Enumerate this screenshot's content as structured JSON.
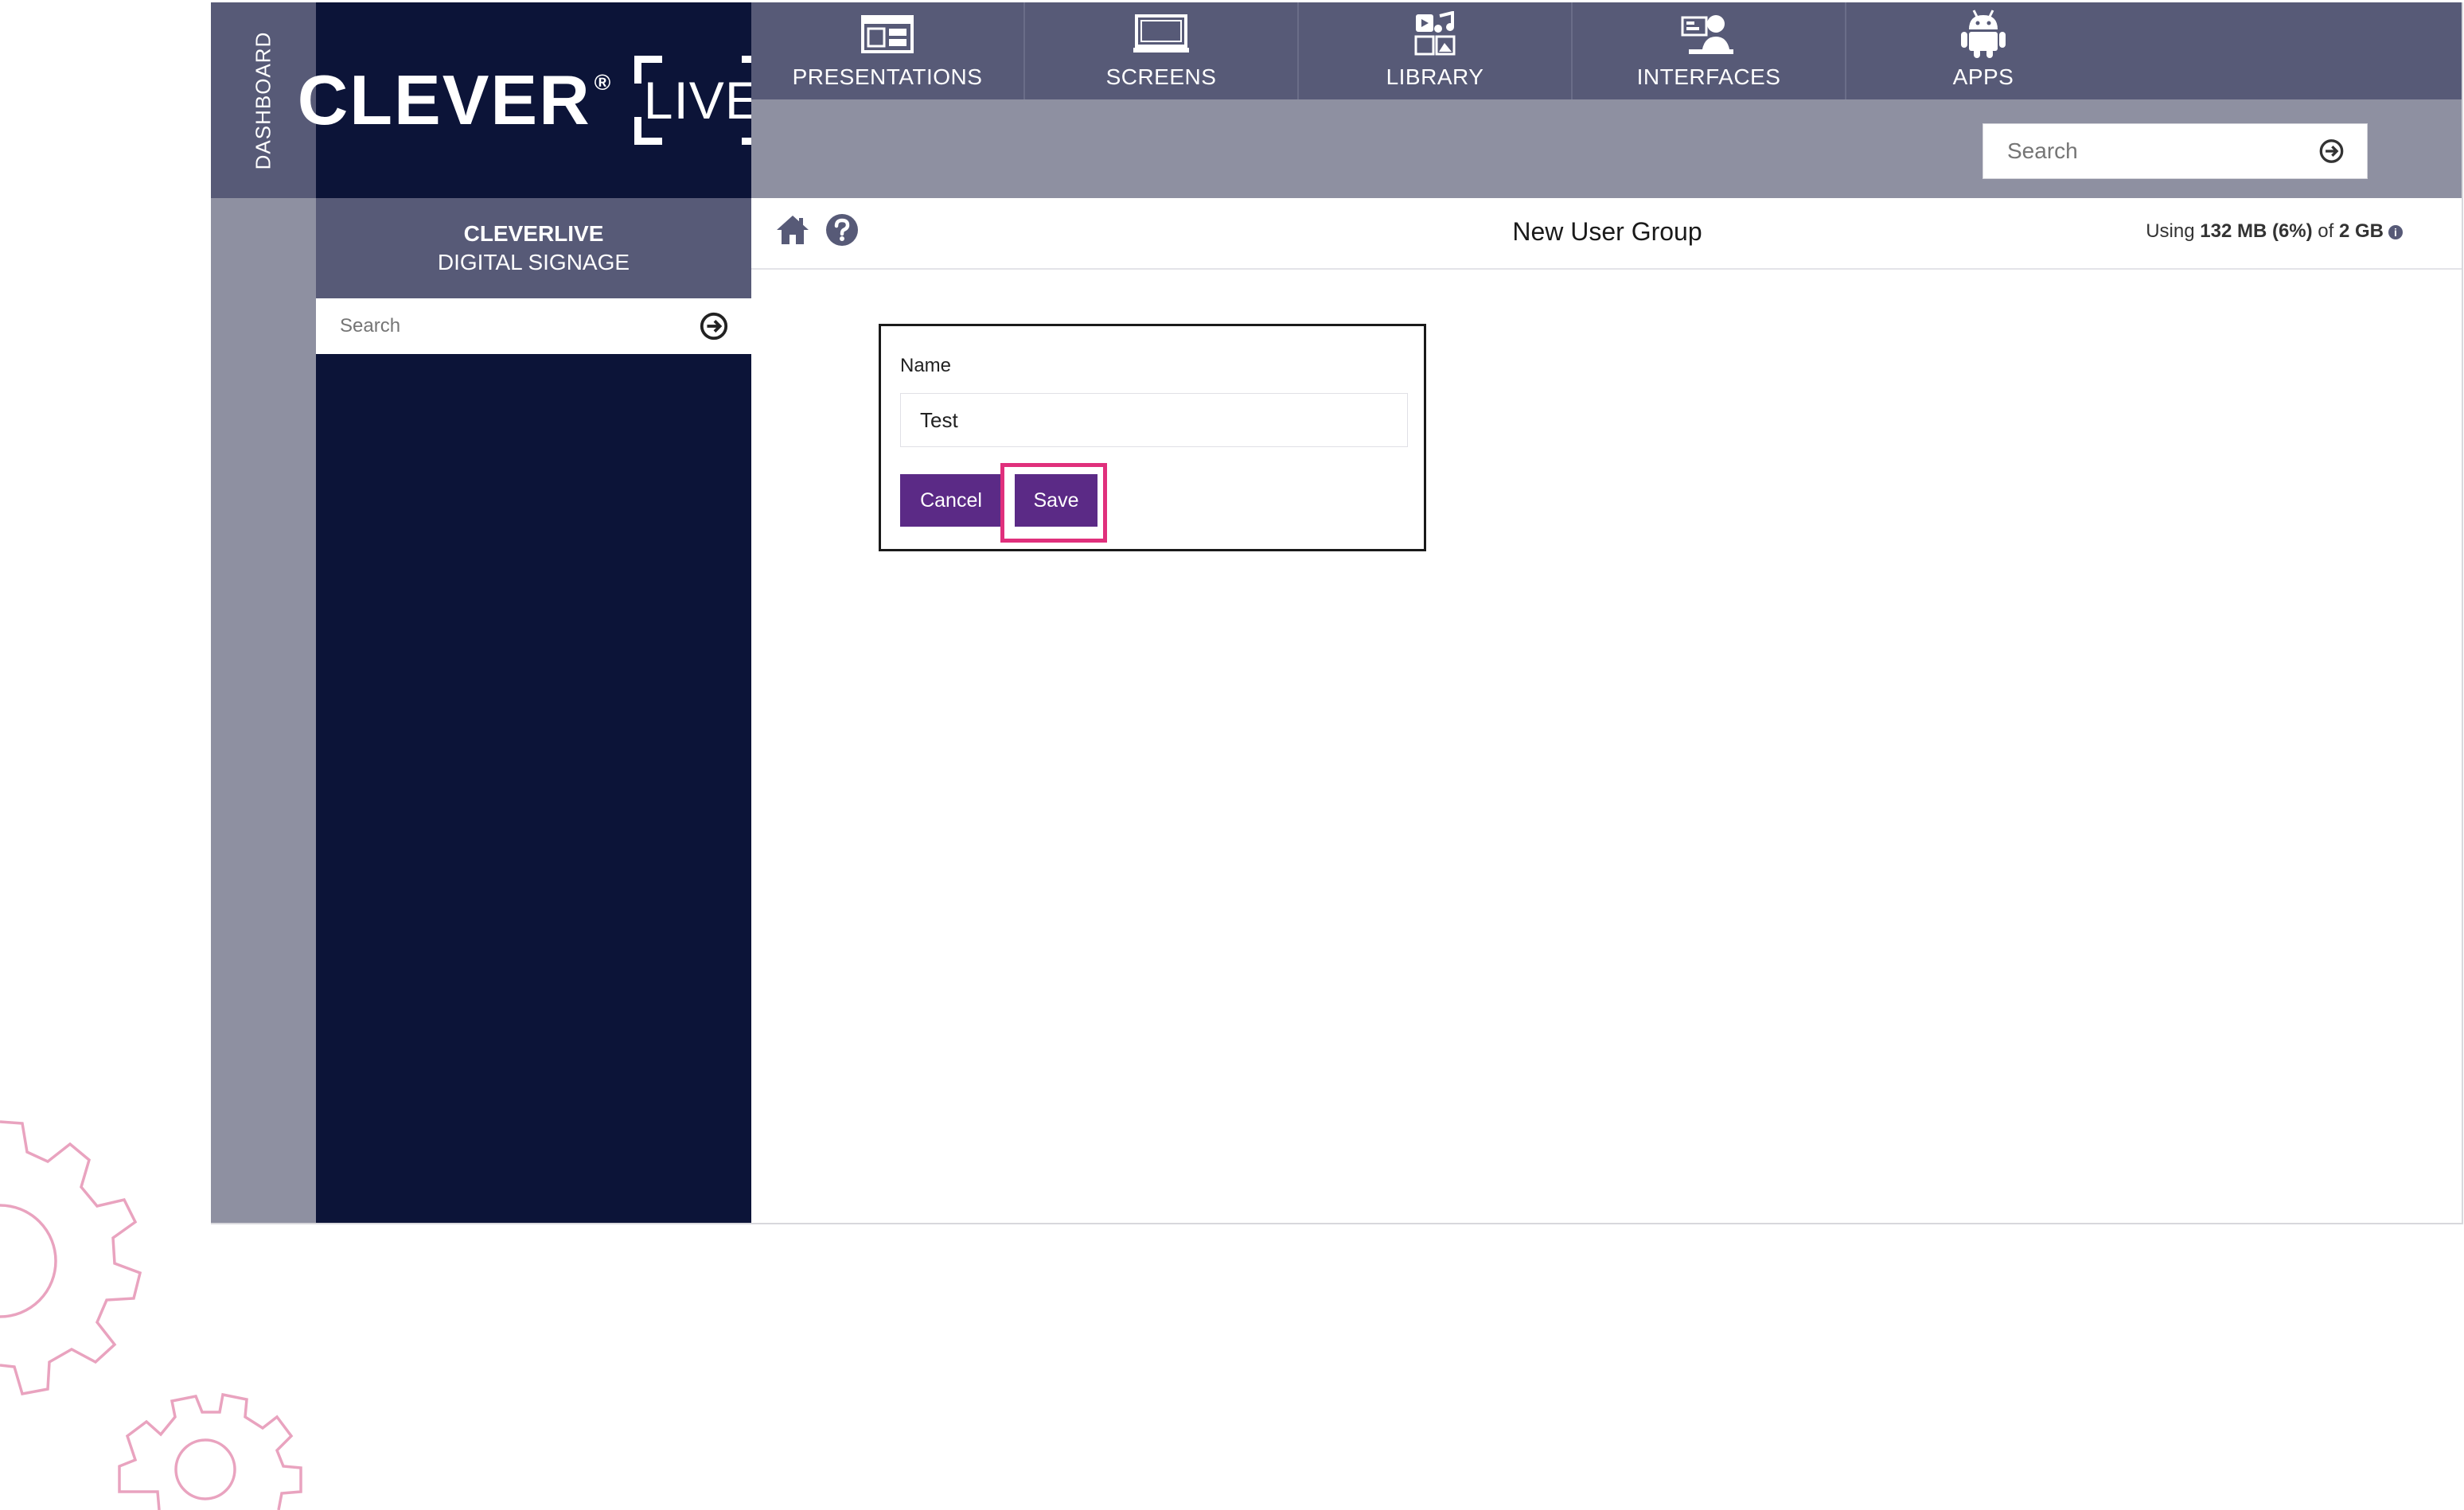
{
  "dashboard_tab": "DASHBOARD",
  "logo": {
    "word": "CLEVER",
    "reg": "®",
    "box_word": "LIVE"
  },
  "nav": [
    {
      "label": "PRESENTATIONS",
      "icon": "presentation-icon"
    },
    {
      "label": "SCREENS",
      "icon": "monitor-icon"
    },
    {
      "label": "LIBRARY",
      "icon": "media-library-icon"
    },
    {
      "label": "INTERFACES",
      "icon": "user-interface-icon"
    },
    {
      "label": "APPS",
      "icon": "android-icon"
    }
  ],
  "top_search": {
    "placeholder": "Search"
  },
  "sidebar": {
    "title_line1": "CLEVERLIVE",
    "title_line2": "DIGITAL SIGNAGE",
    "search_placeholder": "Search"
  },
  "header": {
    "title": "New User Group",
    "usage_prefix": "Using",
    "usage_amount": "132 MB (6%)",
    "usage_of": "of",
    "usage_total": "2 GB"
  },
  "form": {
    "name_label": "Name",
    "name_value": "Test",
    "cancel_label": "Cancel",
    "save_label": "Save"
  },
  "colors": {
    "nav_bg": "#575a77",
    "strip_bg": "#8e90a1",
    "sidebar_bg": "#0c1438",
    "button_purple": "#5b2a86",
    "highlight_pink": "#e0307c",
    "gear_pink": "#e9a3bf"
  }
}
